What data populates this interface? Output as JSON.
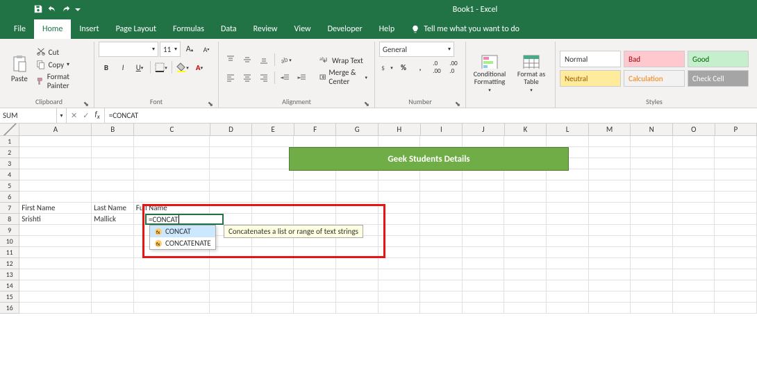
{
  "app_title": "Book1 - Excel",
  "tabs": {
    "file": "File",
    "home": "Home",
    "insert": "Insert",
    "page_layout": "Page Layout",
    "formulas": "Formulas",
    "data": "Data",
    "review": "Review",
    "view": "View",
    "developer": "Developer",
    "help": "Help"
  },
  "tellme": "Tell me what you want to do",
  "ribbon": {
    "clipboard": {
      "paste": "Paste",
      "cut": "Cut",
      "copy": "Copy",
      "format_painter": "Format Painter",
      "label": "Clipboard"
    },
    "font": {
      "size": "11",
      "bold": "B",
      "italic": "I",
      "underline": "U",
      "label": "Font"
    },
    "alignment": {
      "wrap": "Wrap Text",
      "merge": "Merge & Center",
      "label": "Alignment"
    },
    "number": {
      "format": "General",
      "label": "Number"
    },
    "cond": "Conditional Formatting",
    "table": "Format as Table",
    "styles": {
      "normal": "Normal",
      "bad": "Bad",
      "good": "Good",
      "neutral": "Neutral",
      "calc": "Calculation",
      "check": "Check Cell",
      "label": "Styles"
    }
  },
  "namebox": "SUM",
  "formula_bar": "=CONCAT",
  "columns": [
    "A",
    "B",
    "C",
    "D",
    "E",
    "F",
    "G",
    "H",
    "I",
    "J",
    "K",
    "L",
    "M",
    "N",
    "O",
    "P"
  ],
  "rows": [
    "1",
    "2",
    "3",
    "4",
    "5",
    "6",
    "7",
    "8",
    "9",
    "10",
    "11",
    "12",
    "13",
    "14",
    "15",
    "16"
  ],
  "banner": "Geek Students Details",
  "data_cells": {
    "A7": "First Name",
    "B7": "Last Name",
    "C7": "Full Name",
    "A8": "Srishti",
    "B8": "Mallick"
  },
  "active_cell": "=CONCAT",
  "autolist": {
    "opt1": "CONCAT",
    "opt2": "CONCATENATE"
  },
  "tooltip": "Concatenates a list or range of text strings"
}
